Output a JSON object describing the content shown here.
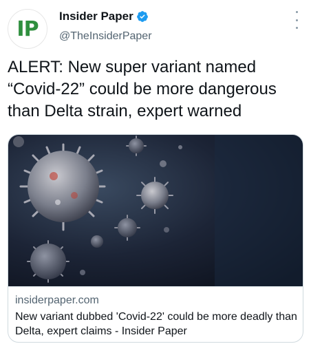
{
  "account": {
    "avatar_text": "IP",
    "display_name": "Insider Paper",
    "handle": "@TheInsiderPaper",
    "verified_color": "#1d9bf0"
  },
  "tweet": {
    "text": "ALERT: New super variant named “Covid-22” could be more dangerous than Delta strain, expert warned"
  },
  "link_card": {
    "domain": "insiderpaper.com",
    "title": "New variant dubbed 'Covid-22' could be more deadly than Delta, expert claims - Insider Paper",
    "image_icon": "coronavirus-particles-image"
  },
  "icons": [
    "verified-badge-icon",
    "more-options-icon"
  ]
}
